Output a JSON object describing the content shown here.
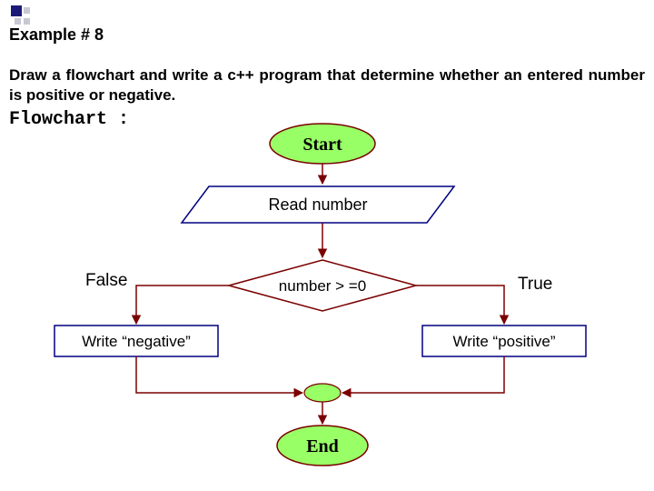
{
  "header": {
    "title": "Example # 8"
  },
  "prompt": "Draw a flowchart and write a c++ program that determine whether an entered number is positive or negative.",
  "flowchart_label": "Flowchart :",
  "nodes": {
    "start": "Start",
    "read": "Read number",
    "decision": "number > =0",
    "false_label": "False",
    "true_label": "True",
    "write_neg": "Write “negative”",
    "write_pos": "Write “positive”",
    "end": "End"
  }
}
